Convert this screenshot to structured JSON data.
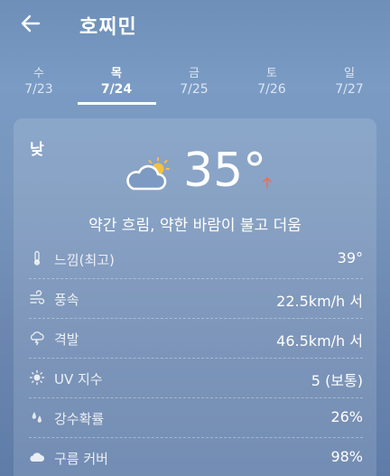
{
  "header": {
    "title": "호찌민"
  },
  "tabs": [
    {
      "dow": "수",
      "date": "7/23"
    },
    {
      "dow": "목",
      "date": "7/24"
    },
    {
      "dow": "금",
      "date": "7/25"
    },
    {
      "dow": "토",
      "date": "7/26"
    },
    {
      "dow": "일",
      "date": "7/27"
    }
  ],
  "active_tab": 1,
  "card": {
    "period": "낮",
    "temperature": "35°",
    "weather_icon": "partly-cloudy-icon",
    "trend_icon": "arrow-up-icon",
    "summary": "약간 흐림, 약한 바람이 불고 더움",
    "rows": [
      {
        "icon": "thermometer-icon",
        "label": "느낌(최고)",
        "value": "39°"
      },
      {
        "icon": "wind-icon",
        "label": "풍속",
        "value": "22.5km/h 서"
      },
      {
        "icon": "gust-icon",
        "label": "격발",
        "value": "46.5km/h 서"
      },
      {
        "icon": "sun-icon",
        "label": "UV 지수",
        "value": "5 (보통)"
      },
      {
        "icon": "rain-icon",
        "label": "강수확률",
        "value": "26%"
      },
      {
        "icon": "cloud-icon",
        "label": "구름 커버",
        "value": "98%"
      }
    ]
  },
  "colors": {
    "accent_trend": "#e8705a",
    "sun": "#f5c044"
  }
}
